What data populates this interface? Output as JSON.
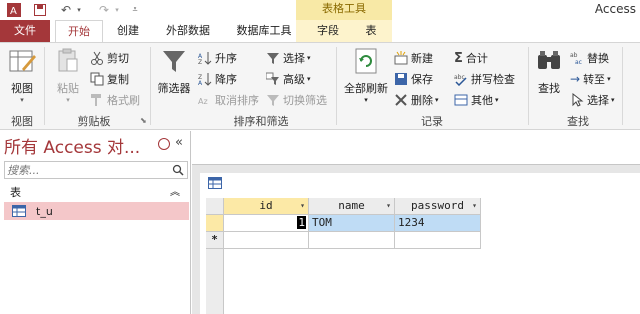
{
  "app": {
    "title": "Access"
  },
  "tabs": {
    "file": "文件",
    "home": "开始",
    "create": "创建",
    "external": "外部数据",
    "dbtools": "数据库工具",
    "fields": "字段",
    "table": "表",
    "context_group": "表格工具"
  },
  "ribbon": {
    "views": {
      "view": "视图",
      "label": "视图"
    },
    "clipboard": {
      "paste": "粘贴",
      "cut": "剪切",
      "copy": "复制",
      "format_painter": "格式刷",
      "label": "剪贴板"
    },
    "sort_filter": {
      "filter": "筛选器",
      "ascending": "升序",
      "descending": "降序",
      "remove_sort": "取消排序",
      "selection": "选择",
      "advanced": "高级",
      "toggle_filter": "切换筛选",
      "label": "排序和筛选"
    },
    "records": {
      "refresh_all": "全部刷新",
      "new": "新建",
      "save": "保存",
      "delete": "删除",
      "totals": "合计",
      "spelling": "拼写检查",
      "more": "其他",
      "label": "记录"
    },
    "find": {
      "find": "查找",
      "replace": "替换",
      "goto": "转至",
      "select": "选择",
      "label": "查找"
    }
  },
  "nav": {
    "title": "所有 Access 对...",
    "search_placeholder": "搜索...",
    "section": "表",
    "items": [
      {
        "label": "t_u"
      }
    ]
  },
  "datasheet": {
    "columns": [
      "id",
      "name",
      "password"
    ],
    "rows": [
      [
        "1",
        "TOM",
        "1234"
      ]
    ],
    "new_row_marker": "*"
  },
  "colors": {
    "accent": "#a4373a",
    "context_tab": "#f8e9a6",
    "selected_row": "#bfdcf5",
    "active_cell": "#fce9a6"
  }
}
